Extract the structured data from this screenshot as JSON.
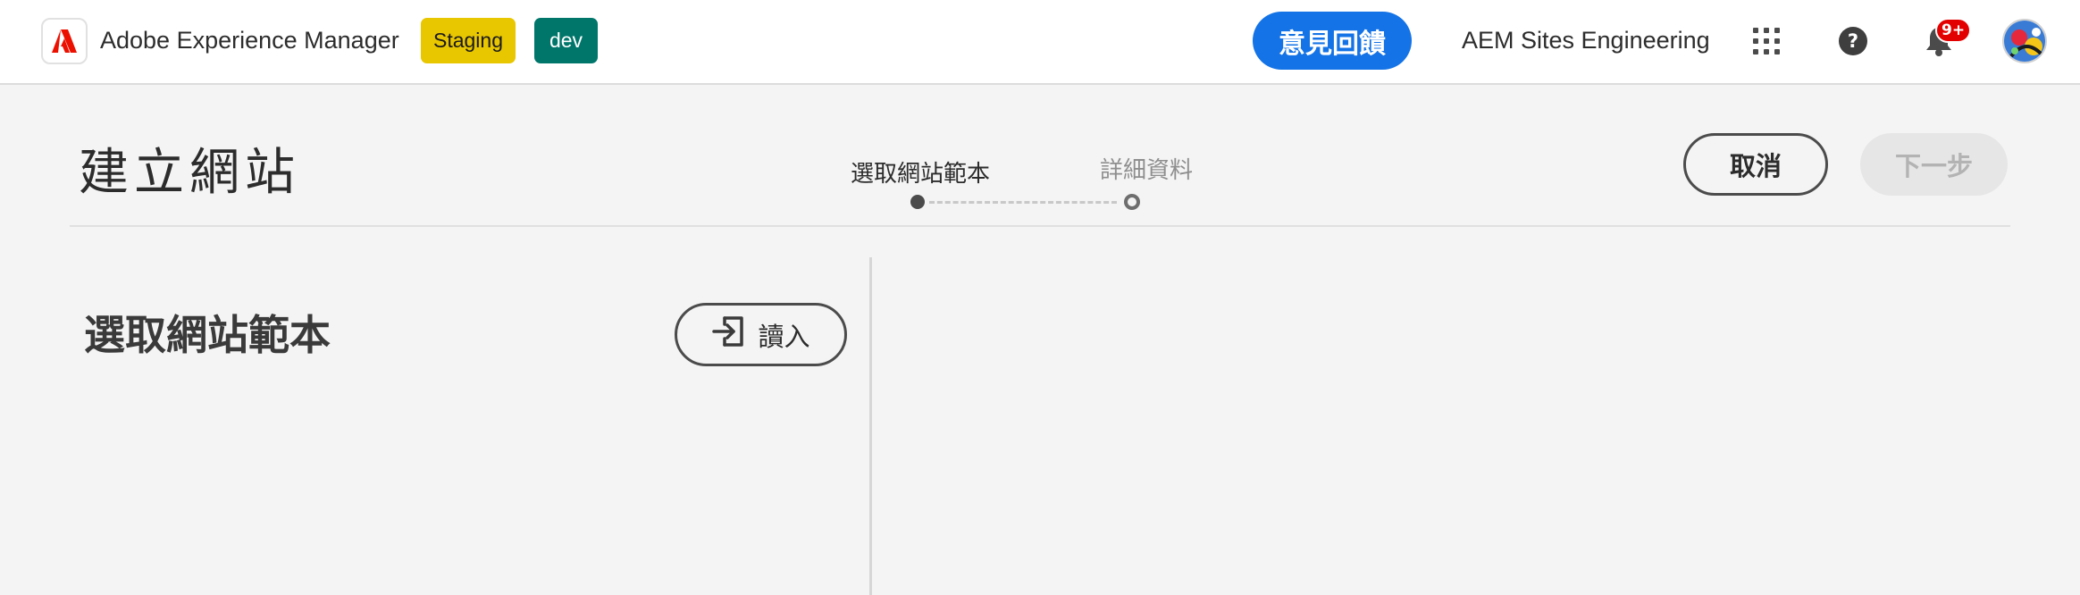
{
  "header": {
    "app_title": "Adobe Experience Manager",
    "logo_icon": "adobe-logo-icon",
    "env_badges": [
      {
        "label": "Staging",
        "color": "#e8c600"
      },
      {
        "label": "dev",
        "color": "#00766b"
      }
    ],
    "feedback_label": "意見回饋",
    "org_name": "AEM Sites Engineering",
    "icons": [
      "apps-grid-icon",
      "help-icon",
      "bell-icon",
      "avatar"
    ],
    "notification_count": "9+",
    "accent_color": "#1473e6"
  },
  "wizard": {
    "title": "建立網站",
    "steps": [
      {
        "label": "選取網站範本",
        "state": "active"
      },
      {
        "label": "詳細資料",
        "state": "pending"
      }
    ],
    "cancel_label": "取消",
    "next_label": "下一步"
  },
  "panel": {
    "title": "選取網站範本",
    "import_label": "讀入",
    "import_icon": "import-icon"
  }
}
